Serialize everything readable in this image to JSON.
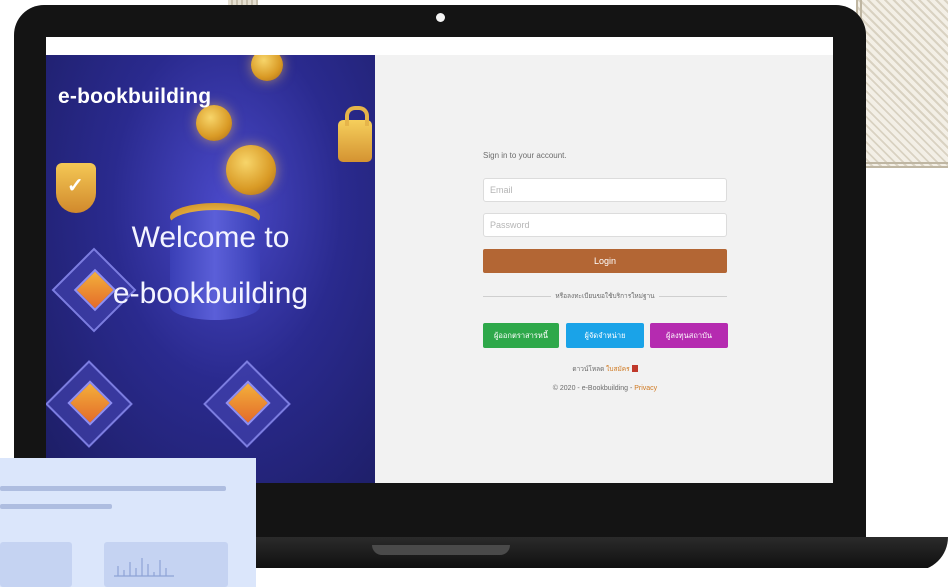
{
  "login_page": {
    "brand": "e-bookbuilding",
    "welcome_line1": "Welcome to",
    "welcome_line2": "e-bookbuilding",
    "signin_prompt": "Sign in to your account.",
    "email_placeholder": "Email",
    "password_placeholder": "Password",
    "login_label": "Login",
    "divider_text": "หรือลงทะเบียนขอใช้บริการใหม่ฐาน",
    "roles": [
      {
        "label": "ผู้ออกตราสารหนี้",
        "color": "#2ea84a"
      },
      {
        "label": "ผู้จัดจำหน่าย",
        "color": "#1aa3e8"
      },
      {
        "label": "ผู้ลงทุนสถาบัน",
        "color": "#b52bb0"
      }
    ],
    "download_prefix": "ดาวน์โหลด",
    "download_link": "ใบสมัคร",
    "copyright_prefix": "© 2020 - e-Bookbuilding - ",
    "privacy_link": "Privacy"
  },
  "colors": {
    "login_button": "#b36634",
    "link": "#d07a22",
    "hero_background": "#2a2a8e"
  }
}
